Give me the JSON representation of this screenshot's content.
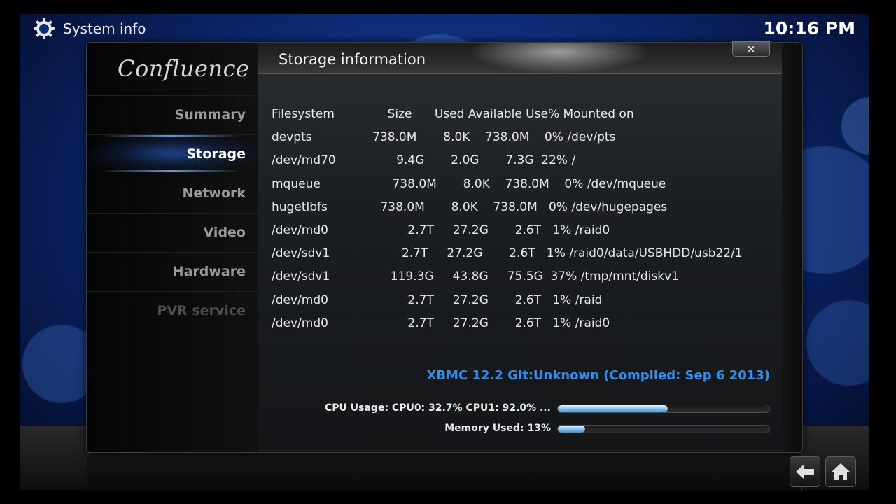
{
  "header": {
    "title": "System info",
    "clock": "10:16 PM",
    "icon": "gear-icon"
  },
  "sidebar": {
    "logo": "Confluence",
    "items": [
      {
        "label": "Summary",
        "state": "normal"
      },
      {
        "label": "Storage",
        "state": "active"
      },
      {
        "label": "Network",
        "state": "normal"
      },
      {
        "label": "Video",
        "state": "normal"
      },
      {
        "label": "Hardware",
        "state": "normal"
      },
      {
        "label": "PVR service",
        "state": "disabled"
      }
    ]
  },
  "content": {
    "title": "Storage information",
    "close_label": "×"
  },
  "storage": {
    "header": "Filesystem              Size      Used Available Use% Mounted on",
    "rows": [
      "devpts                738.0M       8.0K    738.0M    0% /dev/pts",
      "/dev/md70                9.4G       2.0G       7.3G  22% /",
      "mqueue                   738.0M       8.0K    738.0M    0% /dev/mqueue",
      "hugetlbfs              738.0M       8.0K    738.0M   0% /dev/hugepages",
      "/dev/md0                     2.7T     27.2G       2.6T   1% /raid0",
      "/dev/sdv1                   2.7T     27.2G       2.6T   1% /raid0/data/USBHDD/usb22/1",
      "/dev/sdv1                119.3G     43.8G     75.5G  37% /tmp/mnt/diskv1",
      "/dev/md0                     2.7T     27.2G       2.6T   1% /raid",
      "/dev/md0                     2.7T     27.2G       2.6T   1% /raid0"
    ]
  },
  "footer": {
    "version": "XBMC 12.2 Git:Unknown (Compiled: Sep  6 2013)",
    "cpu_label": "CPU Usage: CPU0: 32.7% CPU1: 92.0% ...",
    "cpu_fraction": 0.52,
    "memory_label": "Memory Used: 13%",
    "memory_fraction": 0.13
  },
  "buttons": {
    "back": "back-arrow-icon",
    "home": "home-icon"
  },
  "colors": {
    "accent_blue": "#2f8ff0",
    "background_blue": "#1d4aa6"
  }
}
